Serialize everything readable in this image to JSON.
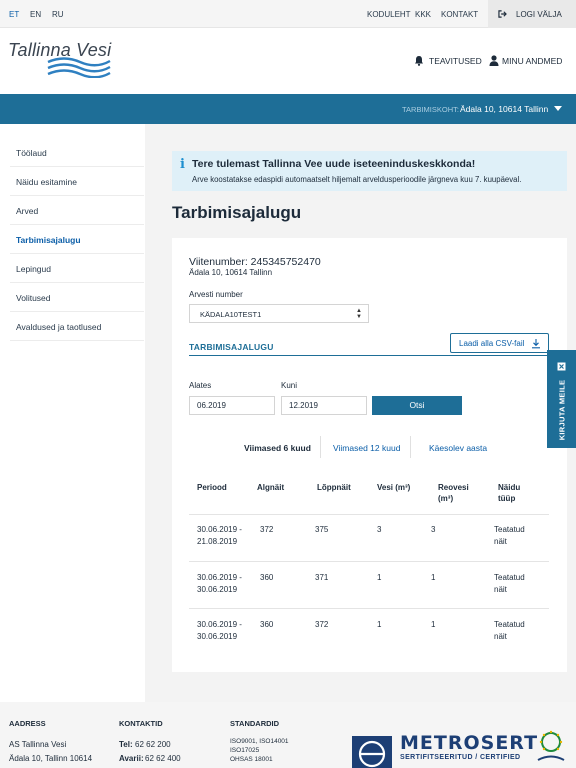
{
  "languages": [
    {
      "code": "ET",
      "active": true
    },
    {
      "code": "EN",
      "active": false
    },
    {
      "code": "RU",
      "active": false
    }
  ],
  "top_links": [
    "KODULEHT",
    "KKK",
    "KONTAKT"
  ],
  "logout_label": "LOGI VÄLJA",
  "logo_text": "Tallinna Vesi",
  "header": {
    "notifications_label": "TEAVITUSED",
    "profile_label": "MINU ANDMED"
  },
  "consumption_place": {
    "label": "TARBIMISKOHT:",
    "value": "Ädala 10, 10614 Tallinn"
  },
  "sidebar": {
    "items": [
      {
        "label": "Töölaud",
        "active": false
      },
      {
        "label": "Näidu esitamine",
        "active": false
      },
      {
        "label": "Arved",
        "active": false
      },
      {
        "label": "Tarbimisajalugu",
        "active": true
      },
      {
        "label": "Lepingud",
        "active": false
      },
      {
        "label": "Volitused",
        "active": false
      },
      {
        "label": "Avaldused ja taotlused",
        "active": false
      }
    ]
  },
  "info": {
    "icon": "info-icon",
    "title": "Tere tulemast Tallinna Vee uude iseteeninduskeskkonda!",
    "text": "Arve koostatakse edaspidi automaatselt hiljemalt arveldusperioodile järgneva kuu 7. kuupäeval."
  },
  "page_title": "Tarbimisajalugu",
  "account": {
    "reference": "Viitenumber: 245345752470",
    "address": "Ädala 10, 10614 Tallinn",
    "meter_label": "Arvesti number",
    "meter_value": "KÄDALA10TEST1"
  },
  "history": {
    "section_title": "TARBIMISAJALUGU",
    "csv_button": "Laadi alla CSV-fail",
    "from_label": "Alates",
    "from_value": "06.2019",
    "to_label": "Kuni",
    "to_value": "12.2019",
    "search_button": "Otsi",
    "tabs": [
      {
        "label": "Viimased 6 kuud",
        "active": true
      },
      {
        "label": "Viimased 12 kuud",
        "active": false
      },
      {
        "label": "Käesolev aasta",
        "active": false
      }
    ],
    "columns": [
      "Periood",
      "Algnäit",
      "Lõppnäit",
      "Vesi (m³)",
      "Reovesi (m³)",
      "Näidu tüüp"
    ],
    "rows": [
      {
        "period_start": "30.06.2019 -",
        "period_end": "21.08.2019",
        "start": "372",
        "end": "375",
        "water": "3",
        "sewage": "3",
        "type_line1": "Teatatud",
        "type_line2": "näit"
      },
      {
        "period_start": "30.06.2019 -",
        "period_end": "30.06.2019",
        "start": "360",
        "end": "371",
        "water": "1",
        "sewage": "1",
        "type_line1": "Teatatud",
        "type_line2": "näit"
      },
      {
        "period_start": "30.06.2019 -",
        "period_end": "30.06.2019",
        "start": "360",
        "end": "372",
        "water": "1",
        "sewage": "1",
        "type_line1": "Teatatud",
        "type_line2": "näit"
      }
    ]
  },
  "feedback_label": "KIRJUTA MEILE",
  "footer": {
    "address_head": "AADRESS",
    "address_line1": "AS Tallinna Vesi",
    "address_line2": "Ädala 10, Tallinn 10614",
    "contacts_head": "KONTAKTID",
    "phone_label": "Tel:",
    "phone_value": "62 62 200",
    "emergency_label": "Avarii:",
    "emergency_value": "62 62 400",
    "standards_head": "STANDARDID",
    "standards": [
      "ISO9001, ISO14001",
      "ISO17025",
      "OHSAS 18001"
    ],
    "certifier_word": "METROSERT",
    "certifier_sub": "SERTIFITSEERITUD / CERTIFIED"
  },
  "colors": {
    "brand_blue": "#1e6e97",
    "link_blue": "#0b5ea8",
    "info_bg": "#dff0f8",
    "main_bg": "#f3f3f3"
  }
}
